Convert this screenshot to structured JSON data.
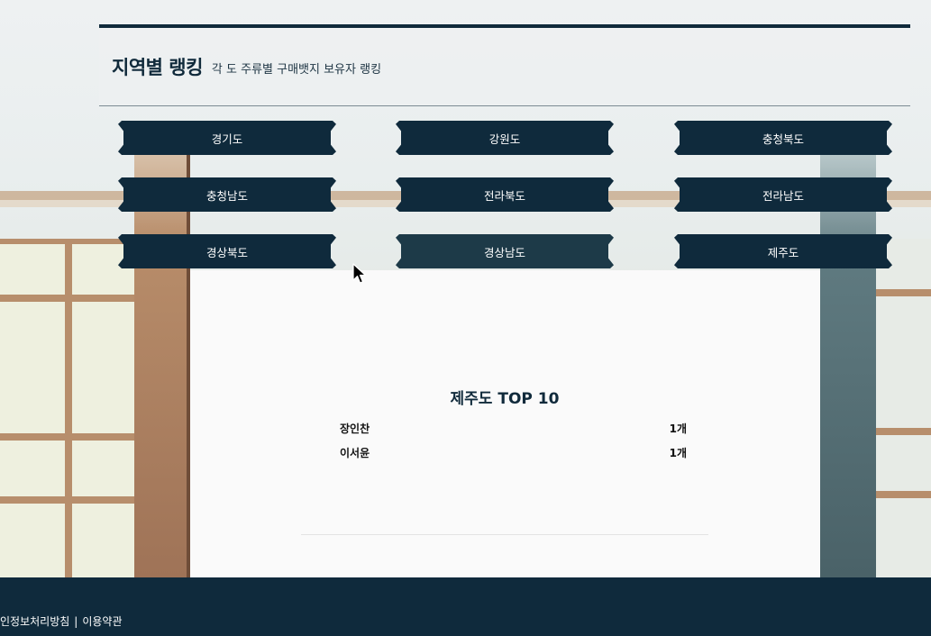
{
  "header": {
    "title": "지역별 랭킹",
    "subtitle": "각 도 주류별 구매뱃지 보유자 랭킹"
  },
  "regions": [
    {
      "label": "경기도"
    },
    {
      "label": "강원도"
    },
    {
      "label": "충청북도"
    },
    {
      "label": "충청남도"
    },
    {
      "label": "전라북도"
    },
    {
      "label": "전라남도"
    },
    {
      "label": "경상북도"
    },
    {
      "label": "경상남도",
      "state": "hover"
    },
    {
      "label": "제주도"
    }
  ],
  "ranking": {
    "title": "제주도 TOP 10",
    "rows": [
      {
        "name": "장인찬",
        "count": "1개"
      },
      {
        "name": "이서윤",
        "count": "1개"
      }
    ]
  },
  "footer": {
    "privacy_link": "인정보처리방침",
    "separator": "|",
    "terms_link": "이용약관"
  },
  "colors": {
    "primary": "#0f2a3c",
    "primary_hover": "#1d3a48",
    "text_on_primary": "#ffffff",
    "card_bg": "#fafafa"
  },
  "icons": {
    "cursor": "mouse-pointer-icon"
  }
}
